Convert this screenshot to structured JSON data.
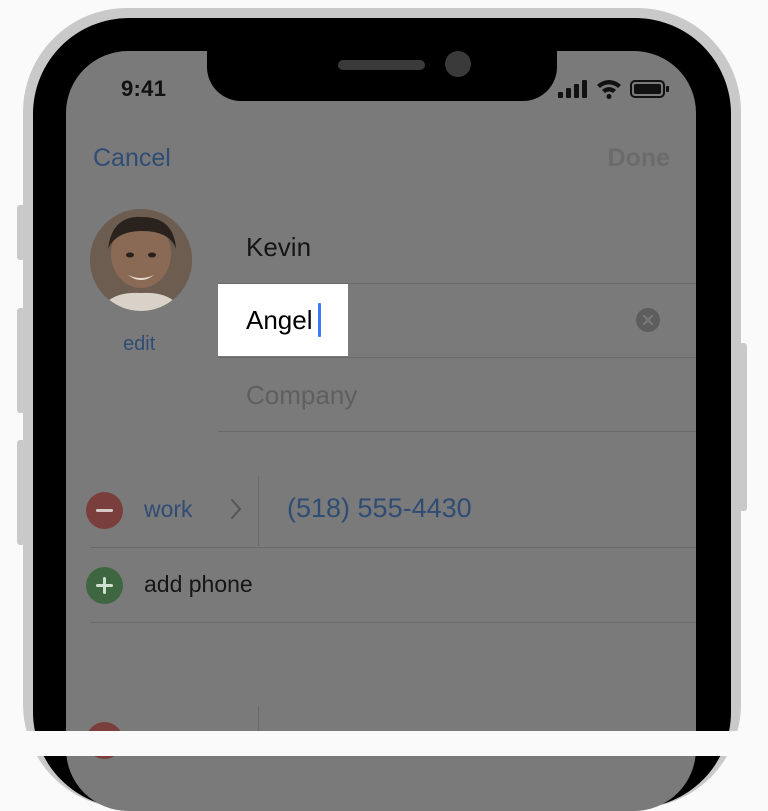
{
  "status_bar": {
    "time": "9:41"
  },
  "nav": {
    "cancel_label": "Cancel",
    "done_label": "Done"
  },
  "contact": {
    "edit_photo_label": "edit",
    "first_name": "Kevin",
    "last_name": "Angel",
    "company_placeholder": "Company"
  },
  "phone": {
    "label": "work",
    "number": "(518) 555-4430",
    "add_label": "add phone"
  },
  "icons": {
    "signal": "cellular-signal-icon",
    "wifi": "wifi-icon",
    "battery": "battery-icon",
    "clear": "clear-text-icon",
    "remove": "minus-circle-icon",
    "add": "plus-circle-icon",
    "chevron": "chevron-right-icon"
  },
  "colors": {
    "link": "#2f4c75",
    "cursor": "#3b7bf7",
    "delete": "#7a3f3d",
    "add": "#3e6640"
  }
}
